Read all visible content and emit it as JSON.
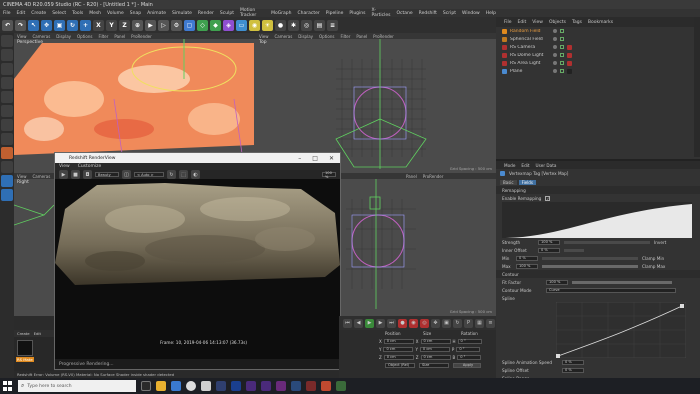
{
  "window": {
    "title": "CINEMA 4D R20.059 Studio (RC - R20) - [Untitled 1 *] - Main",
    "layout_label": "Layout:",
    "layout_value": "Startup"
  },
  "menu": [
    "File",
    "Edit",
    "Create",
    "Select",
    "Tools",
    "Mesh",
    "Volume",
    "Snap",
    "Animate",
    "Simulate",
    "Render",
    "Sculpt",
    "Motion Tracker",
    "MoGraph",
    "Character",
    "Pipeline",
    "Plugins",
    "X-Particles",
    "Octane",
    "Redshift",
    "Script",
    "Window",
    "Help"
  ],
  "toolbar": {
    "axis_labels": [
      "X",
      "Y",
      "Z"
    ],
    "colors": {
      "orange": "#e08a1e",
      "blue": "#2f6fb5",
      "gray": "#555555"
    }
  },
  "viewports": {
    "perspective": {
      "name": "Perspective",
      "menu": [
        "View",
        "Cameras",
        "Display",
        "Options",
        "Filter",
        "Panel",
        "ProRender"
      ]
    },
    "top": {
      "name": "Top",
      "menu": [
        "View",
        "Cameras",
        "Display",
        "Options",
        "Filter",
        "Panel",
        "ProRender"
      ],
      "grid_spacing": "Grid Spacing : 500 cm"
    },
    "right": {
      "name": "Right",
      "menu": [
        "View",
        "Cameras",
        "Display",
        "Options",
        "Filter",
        "Panel",
        "ProRender"
      ]
    },
    "front": {
      "name": "Front",
      "menu": [
        "Panel",
        "ProRender"
      ],
      "grid_spacing": "Grid Spacing : 500 cm"
    }
  },
  "renderview": {
    "title": "Redshift RenderView",
    "menu": [
      "View",
      "Customize"
    ],
    "preset": "Beauty",
    "aov": "< Auto >",
    "zoom": "100 %",
    "stamp": "Frame: 10, 2019-04-06 14:13:07 (36.73s)",
    "status": "Progressive Rendering..."
  },
  "objects": {
    "menu": [
      "File",
      "Edit",
      "View",
      "Objects",
      "Tags",
      "Bookmarks"
    ],
    "items": [
      {
        "name": "Random Field",
        "color": "#e08a1e",
        "selected": true
      },
      {
        "name": "Spherical Field",
        "color": "#c07a20",
        "selected": false
      },
      {
        "name": "RS Camera",
        "color": "#b03030",
        "selected": false
      },
      {
        "name": "RS Dome Light",
        "color": "#b03030",
        "selected": false
      },
      {
        "name": "RS Area Light",
        "color": "#b03030",
        "selected": false
      },
      {
        "name": "Plane",
        "color": "#4a8ad0",
        "selected": false
      }
    ]
  },
  "attributes": {
    "menu": [
      "Mode",
      "Edit",
      "User Data"
    ],
    "tag_title": "Vertexmap Tag [Vertex Map]",
    "tabs": [
      "Basic",
      "Fields"
    ],
    "section": "Remapping",
    "enable_remapping": "Enable Remapping",
    "strength_label": "Strength",
    "strength": "100 %",
    "invert_label": "Invert",
    "inner_offset_label": "Inner Offset",
    "inner_offset": "0 %",
    "min_label": "Min",
    "min": "0 %",
    "max_label": "Max",
    "max": "100 %",
    "clamp_min": "Clamp Min",
    "clamp_max": "Clamp Max",
    "contour_section": "Contour",
    "fit_factor_label": "Fit Factor",
    "fit_factor": "100 %",
    "contour_mode_label": "Contour Mode",
    "contour_mode": "Curve",
    "spline_label": "Spline",
    "spline_anim_label": "Spline Animation Speed",
    "spline_anim": "0 %",
    "spline_offset_label": "Spline Offset",
    "spline_offset": "0 %",
    "spline_range_label": "Spline Range"
  },
  "coordinates": {
    "headers": [
      "Position",
      "Size",
      "Rotation"
    ],
    "rows": [
      {
        "axis": "X",
        "pos": "0 cm",
        "size": "0 cm",
        "rotLabel": "H",
        "rot": "0 °"
      },
      {
        "axis": "Y",
        "pos": "0 cm",
        "size": "0 cm",
        "rotLabel": "P",
        "rot": "0 °"
      },
      {
        "axis": "Z",
        "pos": "0 cm",
        "size": "0 cm",
        "rotLabel": "B",
        "rot": "0 °"
      }
    ],
    "mode": "Object (Rel)",
    "size_mode": "Size",
    "apply": "Apply"
  },
  "materials": {
    "menu": [
      "Create",
      "Edit"
    ],
    "material_name": "RS Mate"
  },
  "statusbar": {
    "text": "Redshift Error: Volume (RS-V0) Material: No Surface Shader inside shader detected"
  },
  "taskbar": {
    "search_placeholder": "Type here to search"
  }
}
